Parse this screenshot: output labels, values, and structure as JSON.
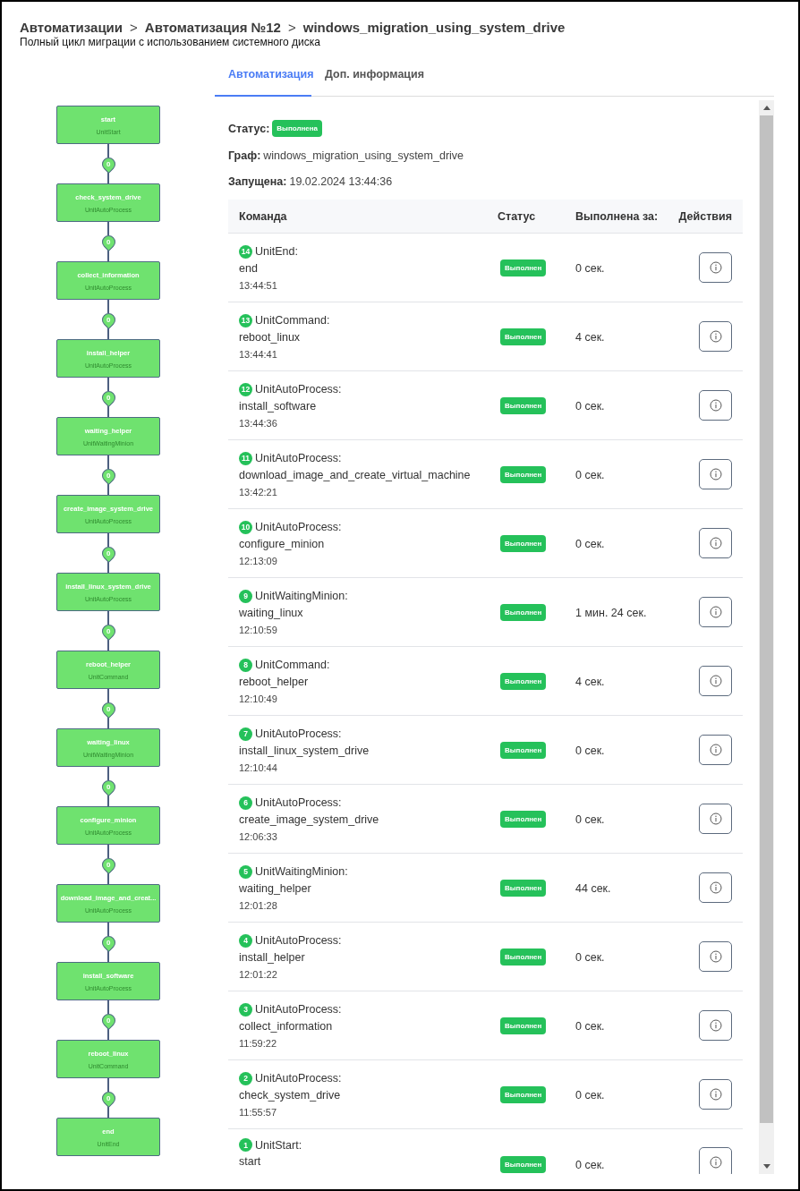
{
  "breadcrumbs": [
    "Автоматизации",
    "Автоматизация №12",
    "windows_migration_using_system_drive"
  ],
  "breadcrumb_separator": ">",
  "subtitle": "Полный цикл миграции с использованием системного диска",
  "graph": {
    "nodes": [
      {
        "name": "start",
        "type": "UnitStart"
      },
      {
        "name": "check_system_drive",
        "type": "UnitAutoProcess"
      },
      {
        "name": "collect_information",
        "type": "UnitAutoProcess"
      },
      {
        "name": "install_helper",
        "type": "UnitAutoProcess"
      },
      {
        "name": "waiting_helper",
        "type": "UnitWaitingMinion"
      },
      {
        "name": "create_image_system_drive",
        "type": "UnitAutoProcess"
      },
      {
        "name": "install_linux_system_drive",
        "type": "UnitAutoProcess"
      },
      {
        "name": "reboot_helper",
        "type": "UnitCommand"
      },
      {
        "name": "waiting_linux",
        "type": "UnitWaitingMinion"
      },
      {
        "name": "configure_minion",
        "type": "UnitAutoProcess"
      },
      {
        "name": "download_image_and_creat...",
        "type": "UnitAutoProcess"
      },
      {
        "name": "install_software",
        "type": "UnitAutoProcess"
      },
      {
        "name": "reboot_linux",
        "type": "UnitCommand"
      },
      {
        "name": "end",
        "type": "UnitEnd"
      }
    ],
    "edges": [
      {
        "label": "0"
      },
      {
        "label": "0"
      },
      {
        "label": "0"
      },
      {
        "label": "0"
      },
      {
        "label": "0"
      },
      {
        "label": "0"
      },
      {
        "label": "0"
      },
      {
        "label": "0"
      },
      {
        "label": "0"
      },
      {
        "label": "0"
      },
      {
        "label": "0"
      },
      {
        "label": "0"
      },
      {
        "label": "0"
      }
    ]
  },
  "tabs": [
    {
      "label": "Автоматизация",
      "selected": true
    },
    {
      "label": "Доп. информация",
      "selected": false
    }
  ],
  "details": {
    "status_label": "Статус:",
    "status": "Выполнена",
    "graph_label": "Граф:",
    "graph": "windows_migration_using_system_drive",
    "started_label": "Запущена:",
    "started": "19.02.2024 13:44:36"
  },
  "table": {
    "columns": [
      "Команда",
      "Статус",
      "Выполнена за:",
      "Действия"
    ],
    "rows": [
      {
        "number": "14",
        "type": "UnitEnd:",
        "name": "end",
        "time": "13:44:51",
        "status": "Выполнен",
        "duration": "0 сек."
      },
      {
        "number": "13",
        "type": "UnitCommand:",
        "name": "reboot_linux",
        "time": "13:44:41",
        "status": "Выполнен",
        "duration": "4 сек."
      },
      {
        "number": "12",
        "type": "UnitAutoProcess:",
        "name": "install_software",
        "time": "13:44:36",
        "status": "Выполнен",
        "duration": "0 сек."
      },
      {
        "number": "11",
        "type": "UnitAutoProcess:",
        "name": "download_image_and_create_virtual_machine",
        "time": "13:42:21",
        "status": "Выполнен",
        "duration": "0 сек."
      },
      {
        "number": "10",
        "type": "UnitAutoProcess:",
        "name": "configure_minion",
        "time": "12:13:09",
        "status": "Выполнен",
        "duration": "0 сек."
      },
      {
        "number": "9",
        "type": "UnitWaitingMinion:",
        "name": "waiting_linux",
        "time": "12:10:59",
        "status": "Выполнен",
        "duration": "1 мин. 24 сек."
      },
      {
        "number": "8",
        "type": "UnitCommand:",
        "name": "reboot_helper",
        "time": "12:10:49",
        "status": "Выполнен",
        "duration": "4 сек."
      },
      {
        "number": "7",
        "type": "UnitAutoProcess:",
        "name": "install_linux_system_drive",
        "time": "12:10:44",
        "status": "Выполнен",
        "duration": "0 сек."
      },
      {
        "number": "6",
        "type": "UnitAutoProcess:",
        "name": "create_image_system_drive",
        "time": "12:06:33",
        "status": "Выполнен",
        "duration": "0 сек."
      },
      {
        "number": "5",
        "type": "UnitWaitingMinion:",
        "name": "waiting_helper",
        "time": "12:01:28",
        "status": "Выполнен",
        "duration": "44 сек."
      },
      {
        "number": "4",
        "type": "UnitAutoProcess:",
        "name": "install_helper",
        "time": "12:01:22",
        "status": "Выполнен",
        "duration": "0 сек."
      },
      {
        "number": "3",
        "type": "UnitAutoProcess:",
        "name": "collect_information",
        "time": "11:59:22",
        "status": "Выполнен",
        "duration": "0 сек."
      },
      {
        "number": "2",
        "type": "UnitAutoProcess:",
        "name": "check_system_drive",
        "time": "11:55:57",
        "status": "Выполнен",
        "duration": "0 сек."
      },
      {
        "number": "1",
        "type": "UnitStart:",
        "name": "start",
        "status": "Выполнен",
        "duration": "0 сек."
      }
    ]
  }
}
